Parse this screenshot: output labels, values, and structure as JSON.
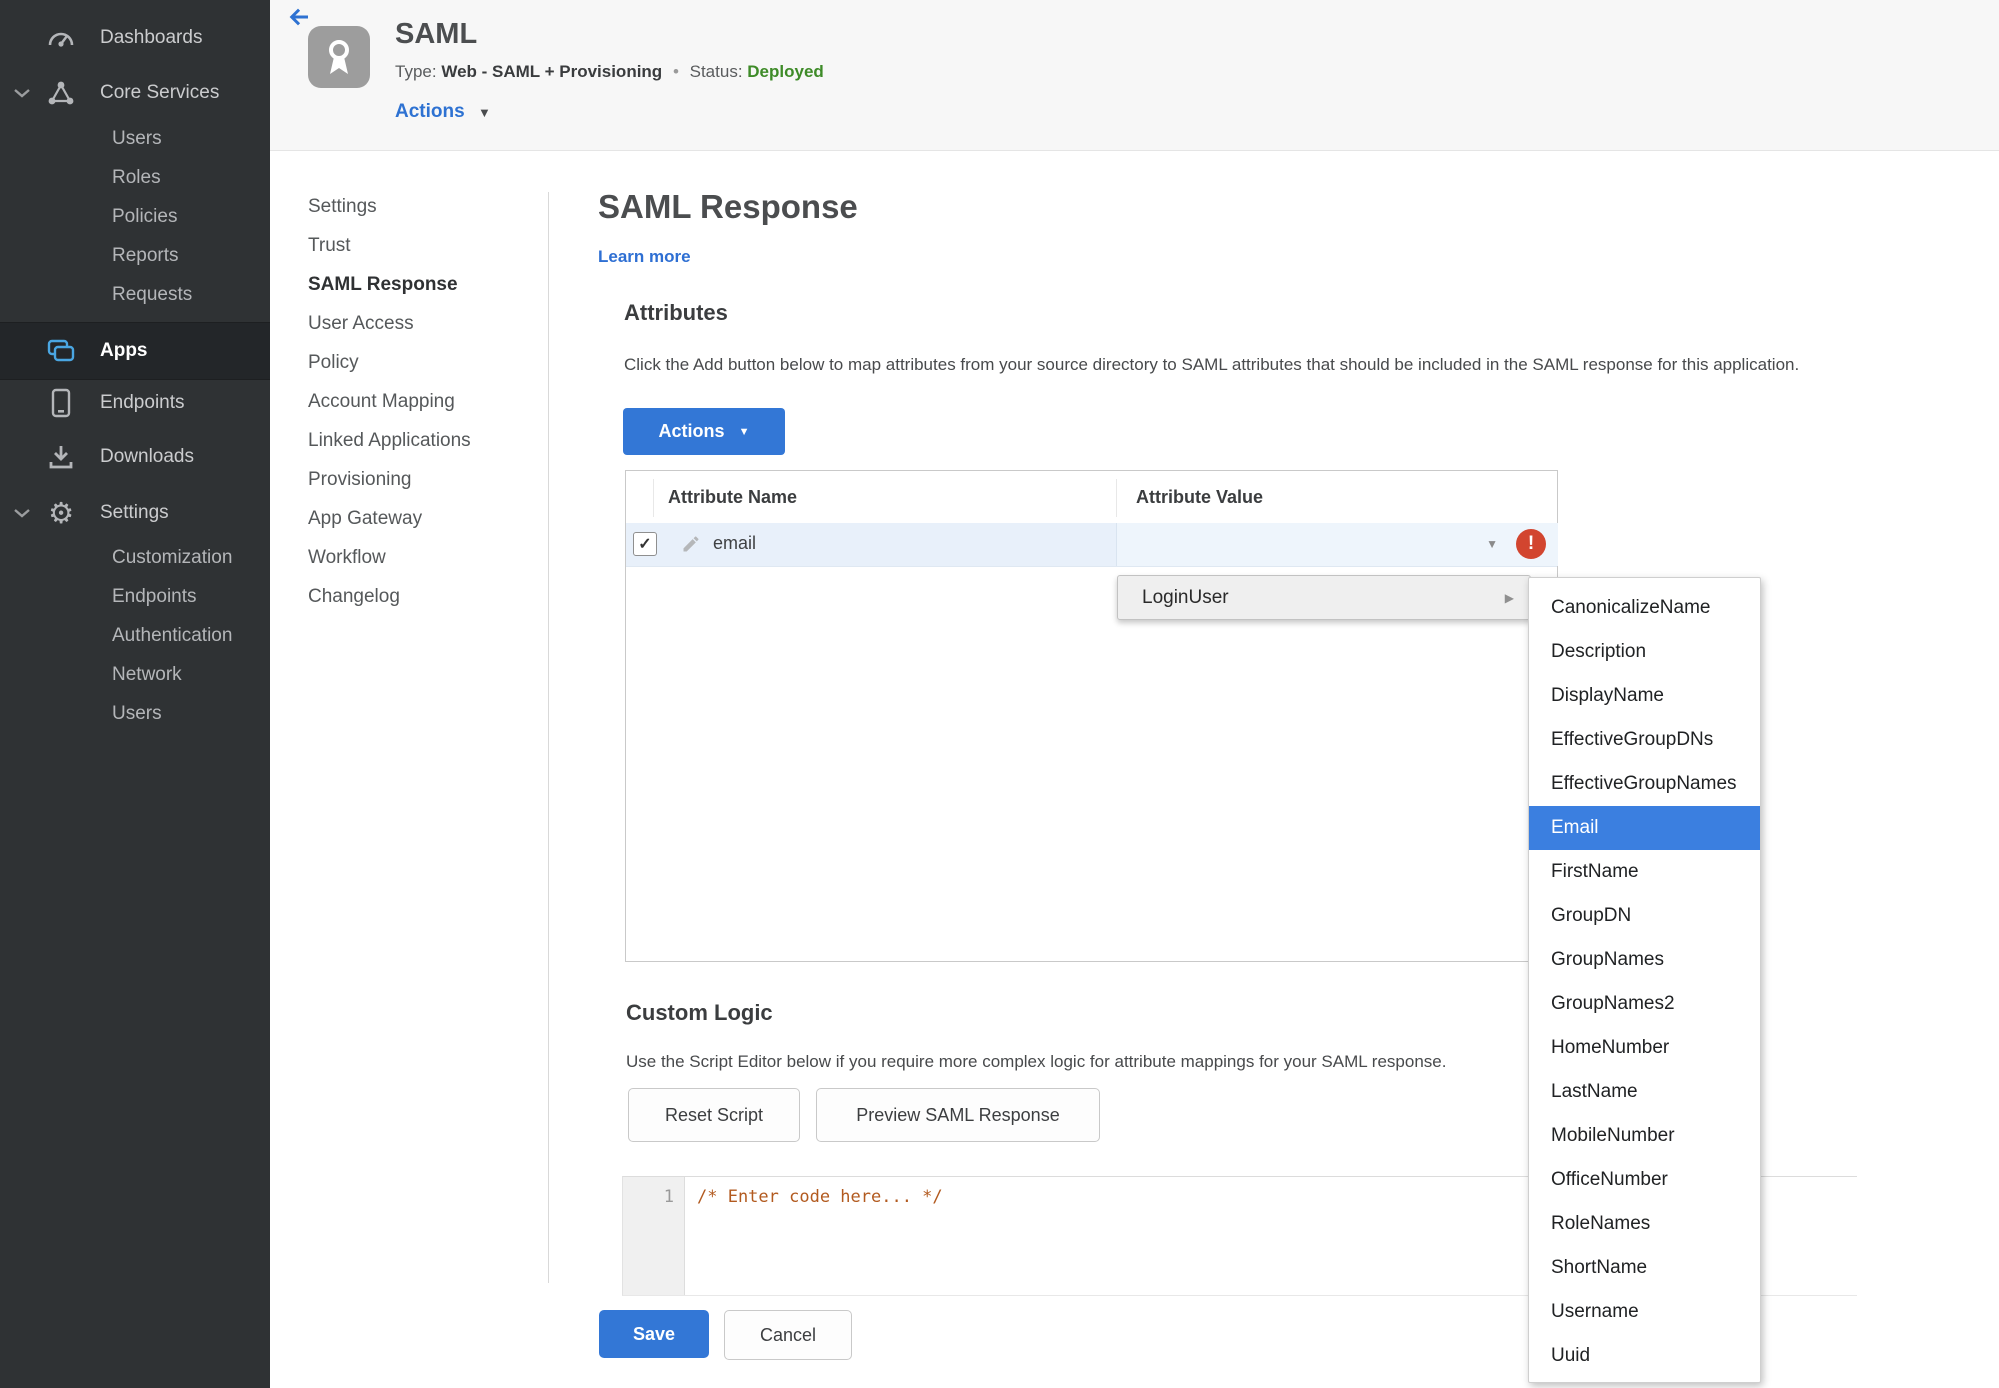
{
  "colors": {
    "sidebar_bg": "#2f3234",
    "sidebar_selected_bg": "#232629",
    "accent_blue": "#3377d6",
    "link_blue": "#2e72d2",
    "status_green": "#3e8b28",
    "error_red": "#d2452f",
    "menu_highlight": "#3b7fe0",
    "row_highlight": "#e8f0fa",
    "code_text": "#b25a1f"
  },
  "icons": {
    "caret_down": "▼",
    "submenu_arrow": "▶",
    "check": "✓",
    "error_glyph": "!"
  },
  "sidebar": {
    "top": [
      {
        "label": "Dashboards",
        "icon": "gauge-icon"
      },
      {
        "label": "Core Services",
        "icon": "molecule-icon"
      },
      {
        "label": "Apps",
        "icon": "apps-icon",
        "selected": true
      },
      {
        "label": "Endpoints",
        "icon": "device-icon"
      },
      {
        "label": "Downloads",
        "icon": "download-icon"
      },
      {
        "label": "Settings",
        "icon": "gear-icon"
      }
    ],
    "core_children": [
      "Users",
      "Roles",
      "Policies",
      "Reports",
      "Requests"
    ],
    "settings_children": [
      "Customization",
      "Endpoints",
      "Authentication",
      "Network",
      "Users"
    ]
  },
  "app": {
    "title": "SAML",
    "type_label": "Type:",
    "type_value": "Web - SAML + Provisioning",
    "dot": "•",
    "status_label": "Status:",
    "status_value": "Deployed",
    "actions_label": "Actions"
  },
  "subnav": {
    "items": [
      "Settings",
      "Trust",
      "SAML Response",
      "User Access",
      "Policy",
      "Account Mapping",
      "Linked Applications",
      "Provisioning",
      "App Gateway",
      "Workflow",
      "Changelog"
    ],
    "active": "SAML Response"
  },
  "main": {
    "title": "SAML Response",
    "learn_more": "Learn more"
  },
  "attrs": {
    "heading": "Attributes",
    "description": "Click the Add button below to map attributes from your source directory to SAML attributes that should be included in the SAML response for this application.",
    "actions_button": "Actions",
    "table": {
      "col_name": "Attribute Name",
      "col_value": "Attribute Value",
      "row_name": "email",
      "row_checked": true,
      "row_value": "",
      "row_has_error": true
    }
  },
  "value_menu": {
    "group_label": "LoginUser",
    "selected": "Email",
    "options": [
      "CanonicalizeName",
      "Description",
      "DisplayName",
      "EffectiveGroupDNs",
      "EffectiveGroupNames",
      "Email",
      "FirstName",
      "GroupDN",
      "GroupNames",
      "GroupNames2",
      "HomeNumber",
      "LastName",
      "MobileNumber",
      "OfficeNumber",
      "RoleNames",
      "ShortName",
      "Username",
      "Uuid"
    ]
  },
  "logic": {
    "heading": "Custom Logic",
    "description": "Use the Script Editor below if you require more complex logic for attribute mappings for your SAML response.",
    "reset_button": "Reset Script",
    "preview_button": "Preview SAML Response",
    "line_number": "1",
    "code": "/* Enter code here... */"
  },
  "footer": {
    "save": "Save",
    "cancel": "Cancel"
  }
}
